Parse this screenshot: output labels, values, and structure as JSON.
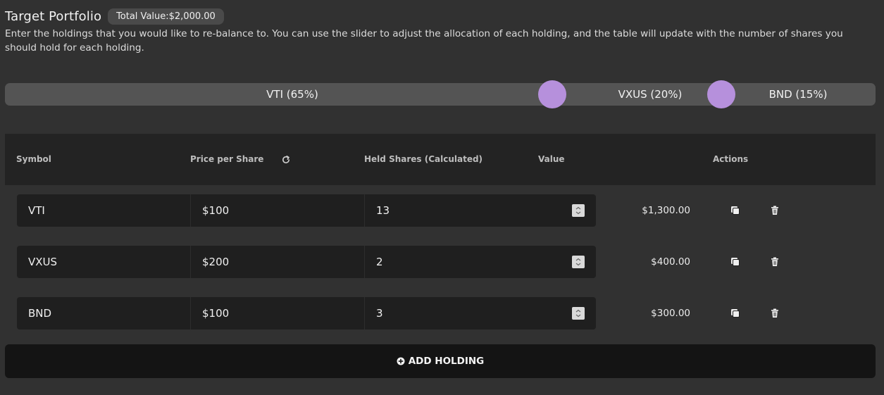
{
  "header": {
    "title": "Target Portfolio",
    "total_value_badge": "Total Value:$2,000.00",
    "description": "Enter the holdings that you would like to re-balance to. You can use the slider to adjust the allocation of each holding, and the table will update with the number of shares you should hold for each holding."
  },
  "allocation_slider": {
    "segments": [
      {
        "label": "VTI (65%)",
        "percent": 65
      },
      {
        "label": "VXUS (20%)",
        "percent": 20
      },
      {
        "label": "BND (15%)",
        "percent": 15
      }
    ],
    "handle_color": "#b690dc"
  },
  "table": {
    "columns": {
      "symbol": "Symbol",
      "price": "Price per Share",
      "held_shares": "Held Shares (Calculated)",
      "value": "Value",
      "actions": "Actions"
    },
    "rows": [
      {
        "symbol": "VTI",
        "price": "$100",
        "shares": "13",
        "value": "$1,300.00"
      },
      {
        "symbol": "VXUS",
        "price": "$200",
        "shares": "2",
        "value": "$400.00"
      },
      {
        "symbol": "BND",
        "price": "$100",
        "shares": "3",
        "value": "$300.00"
      }
    ]
  },
  "add_holding": {
    "label": "ADD HOLDING",
    "icon": "plus-circle-icon"
  },
  "icons": {
    "refresh": "refresh-icon",
    "duplicate": "copy-icon",
    "delete": "trash-icon",
    "spinner": "stepper-icon"
  }
}
